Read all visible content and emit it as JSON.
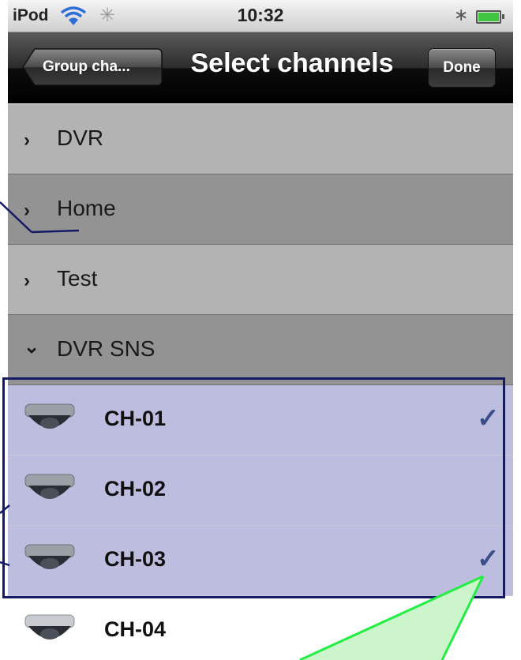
{
  "status_bar": {
    "carrier": "iPod",
    "time": "10:32"
  },
  "nav_bar": {
    "back_label": "Group cha...",
    "title": "Select channels",
    "done_label": "Done"
  },
  "groups": [
    {
      "label": "DVR",
      "expanded": false
    },
    {
      "label": "Home",
      "expanded": false
    },
    {
      "label": "Test",
      "expanded": false
    },
    {
      "label": "DVR SNS",
      "expanded": true
    }
  ],
  "channels": [
    {
      "name": "CH-01",
      "checked": true
    },
    {
      "name": "CH-02",
      "checked": false
    },
    {
      "name": "CH-03",
      "checked": true
    },
    {
      "name": "CH-04",
      "checked": false
    }
  ],
  "icons": {
    "collapsed": "›",
    "expanded": "⌄",
    "check": "✓"
  },
  "colors": {
    "selected_row": "#bdbddf",
    "annotation_box": "#151a66",
    "callout": "#ccf5cc"
  }
}
